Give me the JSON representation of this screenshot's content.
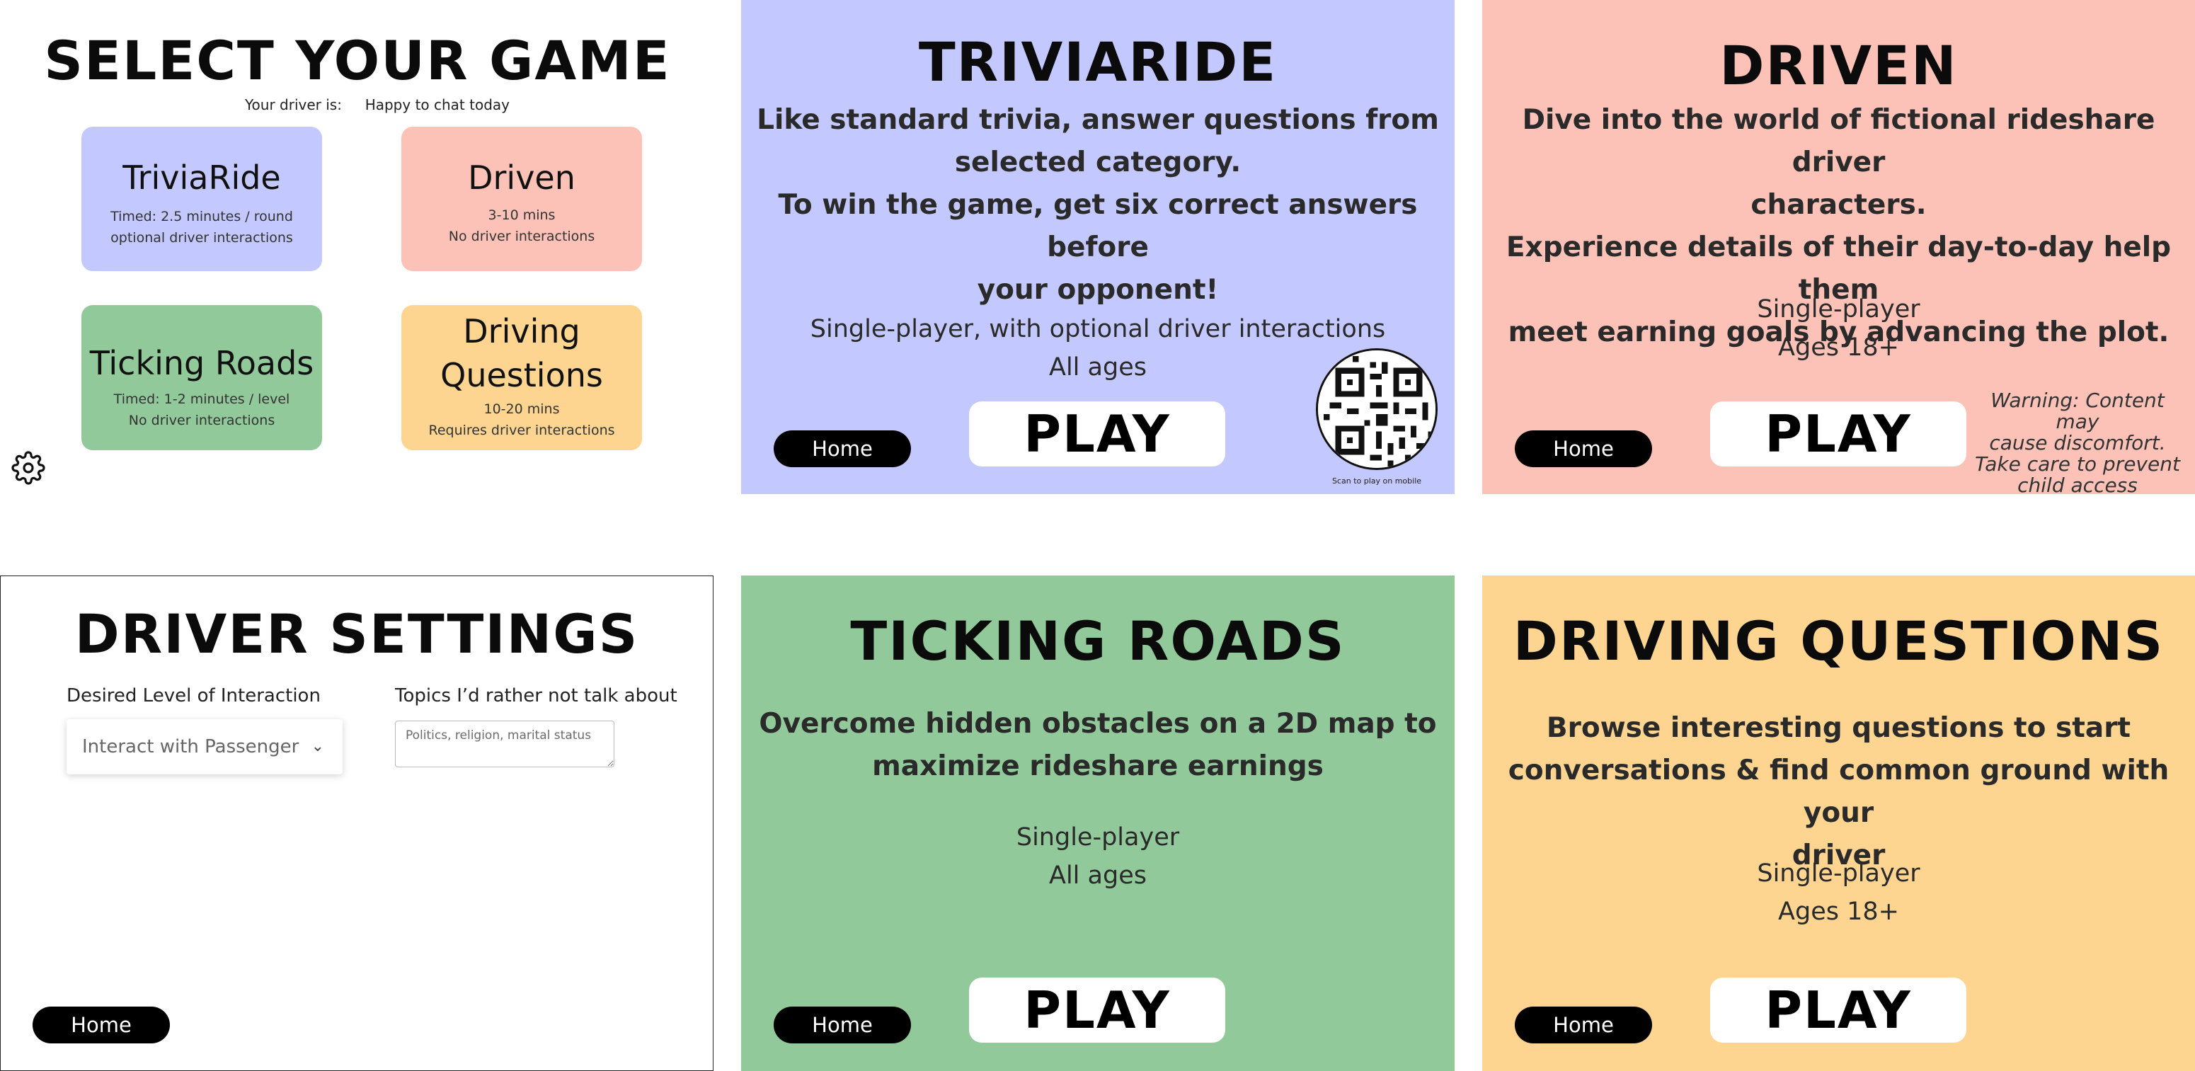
{
  "colors": {
    "triviaride": "#c3c8ff",
    "driven": "#fdc2b7",
    "ticking_roads": "#91c99a",
    "driving_questions": "#fdd591",
    "button_dark": "#000000"
  },
  "select_screen": {
    "title": "SELECT YOUR GAME",
    "driver_label": "Your driver is:",
    "driver_status": "Happy to chat today",
    "settings_icon": "gear-icon",
    "cards": [
      {
        "name": "TriviaRide",
        "line1": "Timed: 2.5 minutes / round",
        "line2": "optional driver interactions"
      },
      {
        "name": "Driven",
        "line1": "3-10 mins",
        "line2": "No driver interactions"
      },
      {
        "name": "Ticking Roads",
        "line1": "Timed: 1-2 minutes / level",
        "line2": "No driver interactions"
      },
      {
        "name_line1": "Driving",
        "name_line2": "Questions",
        "line1": "10-20 mins",
        "line2": "Requires driver interactions"
      }
    ]
  },
  "triviaride": {
    "title": "TRIVIARIDE",
    "desc_line1": "Like standard trivia, answer questions from",
    "desc_line2": "selected category.",
    "desc_line3": "To win the game, get six correct answers before",
    "desc_line4": "your opponent!",
    "players": "Single-player, with optional driver interactions",
    "ages": "All ages",
    "home_label": "Home",
    "play_label": "PLAY",
    "qr_caption": "Scan to play on mobile"
  },
  "driven": {
    "title": "DRIVEN",
    "desc_line1": "Dive into the world of fictional rideshare driver",
    "desc_line2": "characters.",
    "desc_line3": "Experience details of their day-to-day help them",
    "desc_line4": "meet earning goals by advancing the plot.",
    "players": "Single-player",
    "ages": "Ages 18+",
    "home_label": "Home",
    "play_label": "PLAY",
    "warning_line1": "Warning: Content may",
    "warning_line2": "cause discomfort.",
    "warning_line3": "Take care to prevent",
    "warning_line4": "child access"
  },
  "driver_settings": {
    "title": "DRIVER SETTINGS",
    "interaction_label": "Desired Level of Interaction",
    "interaction_value": "Interact with Passenger",
    "topics_label": "Topics I’d rather not talk about",
    "topics_placeholder": "Politics, religion, marital status",
    "home_label": "Home"
  },
  "ticking_roads": {
    "title": "TICKING ROADS",
    "desc_line1": "Overcome hidden obstacles on a 2D map to",
    "desc_line2": "maximize rideshare earnings",
    "players": "Single-player",
    "ages": "All ages",
    "home_label": "Home",
    "play_label": "PLAY"
  },
  "driving_questions": {
    "title": "DRIVING QUESTIONS",
    "desc_line1": "Browse interesting questions to start",
    "desc_line2": "conversations & find common ground with your",
    "desc_line3": "driver",
    "players": "Single-player",
    "ages": "Ages 18+",
    "home_label": "Home",
    "play_label": "PLAY"
  }
}
